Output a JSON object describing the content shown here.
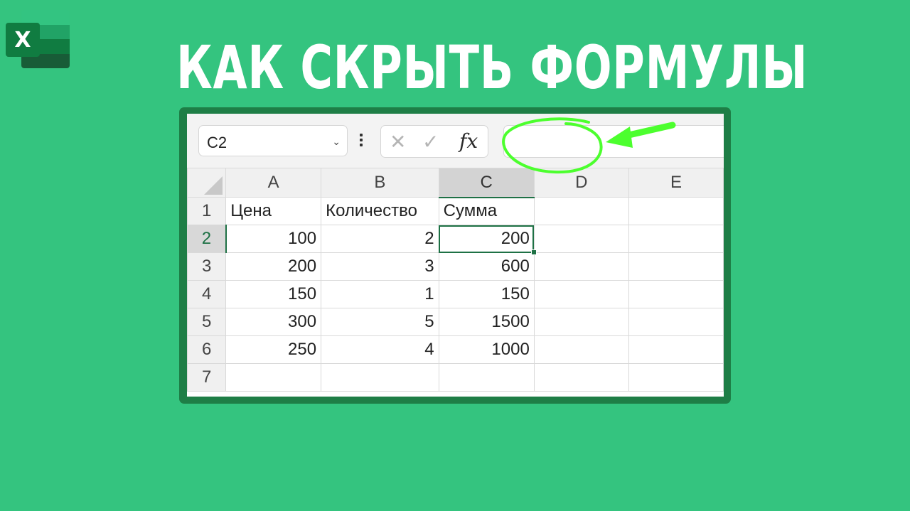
{
  "title": "КАК СКРЫТЬ ФОРМУЛЫ",
  "logo": {
    "letter": "X",
    "name": "excel-logo"
  },
  "formula_bar": {
    "name_box": "C2",
    "name_box_arrow": "⌄",
    "cancel_glyph": "✕",
    "enter_glyph": "✓",
    "fx_label": "fx",
    "formula_value": ""
  },
  "columns": [
    "A",
    "B",
    "C",
    "D",
    "E"
  ],
  "rows": [
    {
      "num": "1",
      "cells": [
        "Цена",
        "Количество",
        "Сумма",
        "",
        ""
      ]
    },
    {
      "num": "2",
      "cells": [
        "100",
        "2",
        "200",
        "",
        ""
      ]
    },
    {
      "num": "3",
      "cells": [
        "200",
        "3",
        "600",
        "",
        ""
      ]
    },
    {
      "num": "4",
      "cells": [
        "150",
        "1",
        "150",
        "",
        ""
      ]
    },
    {
      "num": "5",
      "cells": [
        "300",
        "5",
        "1500",
        "",
        ""
      ]
    },
    {
      "num": "6",
      "cells": [
        "250",
        "4",
        "1000",
        "",
        ""
      ]
    },
    {
      "num": "7",
      "cells": [
        "",
        "",
        "",
        "",
        ""
      ]
    }
  ],
  "selected_cell": "C2",
  "colors": {
    "background": "#34c47f",
    "excel_green": "#107c41",
    "frame_green": "#1e7e46",
    "annotation": "#4cff2e"
  }
}
